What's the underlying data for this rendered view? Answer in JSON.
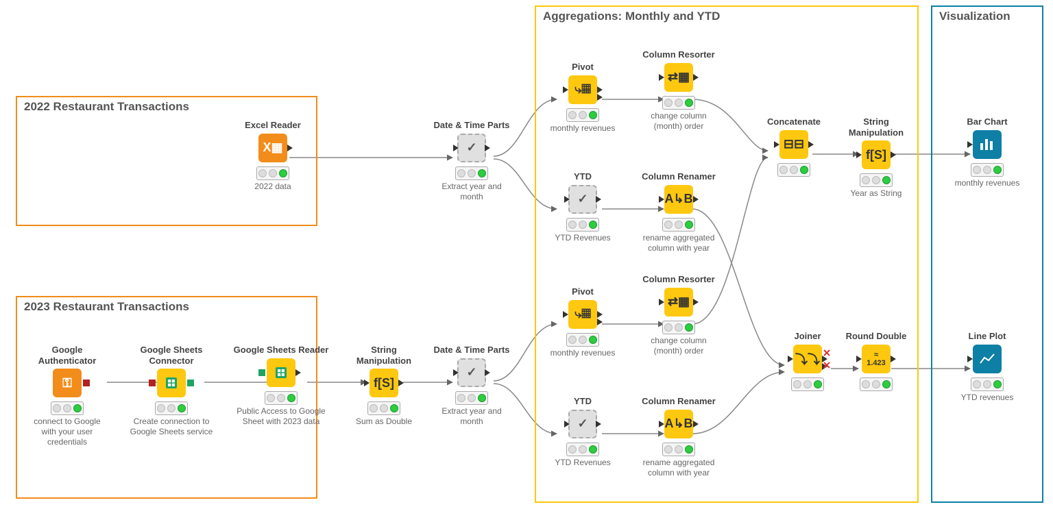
{
  "groups": {
    "g2022": {
      "title": "2022 Restaurant Transactions"
    },
    "g2023": {
      "title": "2023 Restaurant Transactions"
    },
    "agg": {
      "title": "Aggregations: Monthly and YTD"
    },
    "viz": {
      "title": "Visualization"
    }
  },
  "nodes": {
    "excel": {
      "title": "Excel Reader",
      "caption": "2022 data"
    },
    "dtp1": {
      "title": "Date & Time Parts",
      "caption": "Extract year and month"
    },
    "pivot1": {
      "title": "Pivot",
      "caption": "monthly revenues"
    },
    "resort1": {
      "title": "Column Resorter",
      "caption": "change column (month) order"
    },
    "ytd1": {
      "title": "YTD",
      "caption": "YTD Revenues"
    },
    "rename1": {
      "title": "Column Renamer",
      "caption": "rename aggregated column with year"
    },
    "concat": {
      "title": "Concatenate",
      "caption": ""
    },
    "strman2": {
      "title": "String Manipulation",
      "caption": "Year as String"
    },
    "bar": {
      "title": "Bar Chart",
      "caption": "monthly revenues"
    },
    "gauth": {
      "title": "Google Authenticator",
      "caption": "connect to Google with your user credentials"
    },
    "gconn": {
      "title": "Google Sheets Connector",
      "caption": "Create connection to Google Sheets service"
    },
    "gread": {
      "title": "Google Sheets Reader",
      "caption": "Public Access to Google Sheet with 2023 data"
    },
    "strman1": {
      "title": "String Manipulation",
      "caption": "Sum as Double"
    },
    "dtp2": {
      "title": "Date & Time Parts",
      "caption": "Extract year and month"
    },
    "pivot2": {
      "title": "Pivot",
      "caption": "monthly revenues"
    },
    "resort2": {
      "title": "Column Resorter",
      "caption": "change column (month) order"
    },
    "ytd2": {
      "title": "YTD",
      "caption": "YTD Revenues"
    },
    "rename2": {
      "title": "Column Renamer",
      "caption": "rename aggregated column with year"
    },
    "joiner": {
      "title": "Joiner",
      "caption": ""
    },
    "round": {
      "title": "Round Double",
      "caption": ""
    },
    "line": {
      "title": "Line Plot",
      "caption": "YTD revenues"
    }
  }
}
